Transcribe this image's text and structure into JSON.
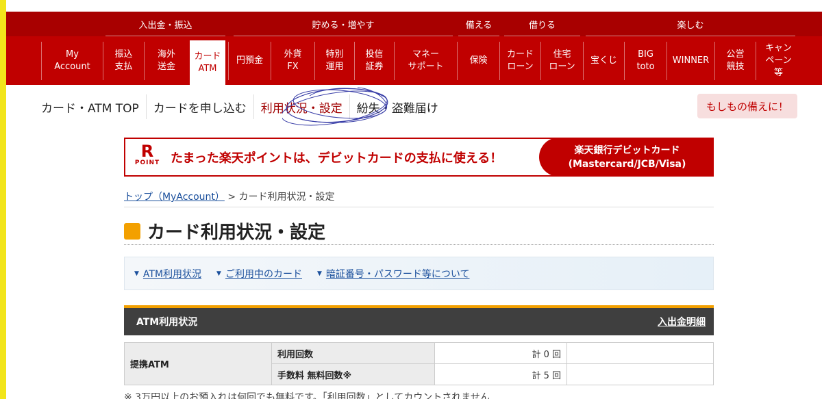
{
  "nav": {
    "categories": [
      "入出金・振込",
      "貯める・増やす",
      "備える",
      "借りる",
      "楽しむ"
    ],
    "items": [
      "My\nAccount",
      "振込\n支払",
      "海外\n送金",
      "カード\nATM",
      "円預金",
      "外貨\nFX",
      "特別\n運用",
      "投信\n証券",
      "マネー\nサポート",
      "保険",
      "カード\nローン",
      "住宅\nローン",
      "宝くじ",
      "BIG\ntoto",
      "WINNER",
      "公営\n競技",
      "キャン\nペーン\n等"
    ]
  },
  "subnav": {
    "items": [
      "カード・ATM TOP",
      "カードを申し込む",
      "利用状況・設定",
      "紛失・盗難届け"
    ],
    "warn_button": "もしもの備えに！"
  },
  "banner": {
    "logo_r": "R",
    "logo_point": "POINT",
    "text": "たまった楽天ポイントは、デビットカードの支払に使える！",
    "right_line1": "楽天銀行デビットカード",
    "right_line2": "(Mastercard/JCB/Visa)"
  },
  "breadcrumb": {
    "home": "トップ（MyAccount）",
    "separator": " > ",
    "current": "カード利用状況・設定"
  },
  "page_title": "カード利用状況・設定",
  "anchors": [
    "ATM利用状況",
    "ご利用中のカード",
    "暗証番号・パスワード等について"
  ],
  "section": {
    "title": "ATM利用状況",
    "link": "入出金明細"
  },
  "atm_table": {
    "group_label": "提携ATM",
    "rows": [
      {
        "label": "利用回数",
        "value": "計 0 回"
      },
      {
        "label": "手数料 無料回数※",
        "value": "計 5 回"
      }
    ]
  },
  "note": "※ 3万円以上のお預入れは何回でも無料です。「利用回数」としてカウントされません"
}
